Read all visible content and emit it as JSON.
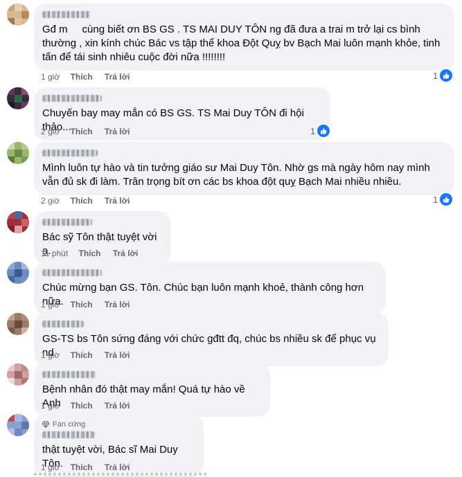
{
  "actions": {
    "like": "Thích",
    "reply": "Trả lời"
  },
  "comments": [
    {
      "text": "Gđ m     cùng biết ơn BS GS . TS MAI DUY TÔN ng đã đưa a trai m trở lại cs bình thường , xin kính chúc Bác vs tập thể khoa Đột Quỵ bv Bạch Mai luôn mạnh khỏe, tinh tấn để tái sinh nhiêu cuộc đời nữa !!!!!!!!",
      "time": "1 giờ",
      "likes": "1",
      "badge": "",
      "avatar_color": "#c9a27a"
    },
    {
      "text": "Chuyến bay may mắn có BS GS. TS Mai Duy TÔN đi hội thảo...",
      "time": "2 giờ",
      "likes": "1",
      "badge": "",
      "avatar_color": "#4a2a4a"
    },
    {
      "text": "Mình luôn tự hào và tin tưởng giáo sư Mai Duy Tôn. Nhờ gs mà ngày hôm nay mình vẫn đủ sk đi làm. Trân trọng bít ơn các bs khoa đột quỵ Bạch Mai nhiều nhiều.",
      "time": "2 giờ",
      "likes": "1",
      "badge": "",
      "avatar_color": "#8aa85a"
    },
    {
      "text": "Bác sỹ Tôn thật tuyệt vời ạ.",
      "time": "11 phút",
      "likes": "",
      "badge": "",
      "avatar_color": "#b0303a"
    },
    {
      "text": "Chúc mừng bạn GS. Tôn. Chúc bạn luôn mạnh khoẻ, thành công hơn nữa.",
      "time": "1 giờ",
      "likes": "",
      "badge": "",
      "avatar_color": "#5a7ab0"
    },
    {
      "text": "GS-TS bs Tôn sứng đáng với chức gđtt đq, chúc bs nhiều sk để phục vụ nd",
      "time": "1 giờ",
      "likes": "",
      "badge": "",
      "avatar_color": "#8a6a5a"
    },
    {
      "text": "Bệnh nhân đó thật may mắn! Quá tự hào về Anh",
      "time": "1 giờ",
      "likes": "",
      "badge": "",
      "avatar_color": "#c08080"
    },
    {
      "text": "thật tuyệt vời, Bác sĩ Mai Duy Tôn.",
      "time": "1 giờ",
      "likes": "",
      "badge": "Fan cứng",
      "avatar_color": "#7a90c8"
    }
  ]
}
